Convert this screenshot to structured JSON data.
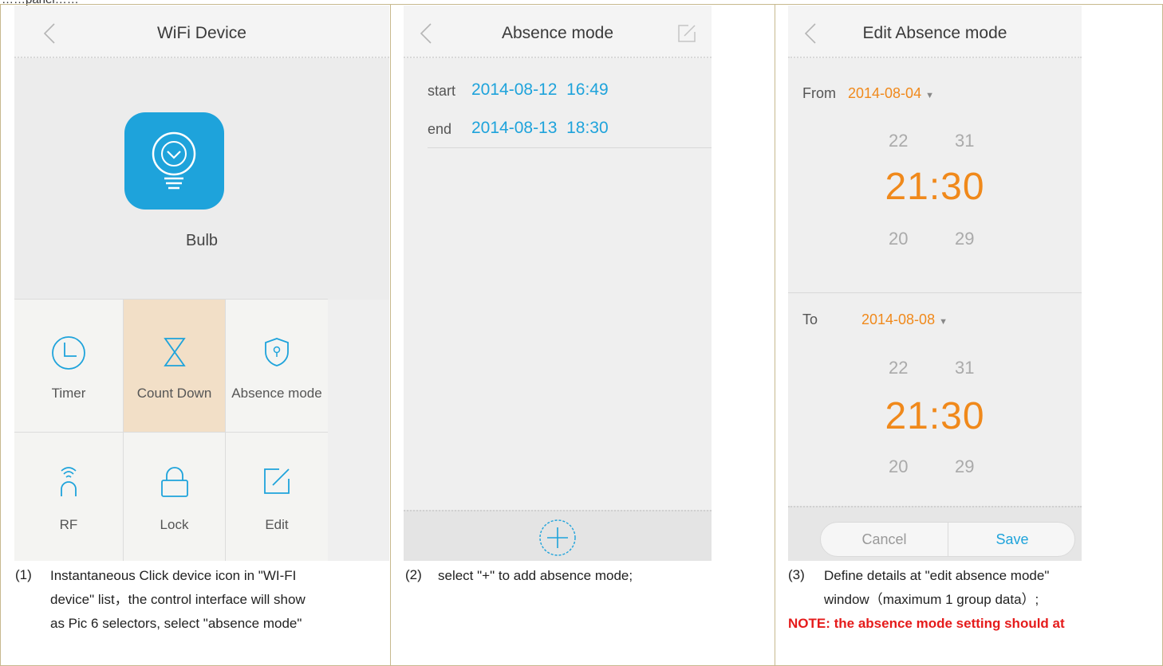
{
  "top_fragment": "……panel……",
  "panel1": {
    "title": "WiFi Device",
    "device_label": "Bulb",
    "menu": [
      "Timer",
      "Count Down",
      "Absence mode",
      "RF",
      "Lock",
      "Edit"
    ],
    "caption_number": "(1)",
    "caption_lines": [
      "Instantaneous Click device icon in \"WI-FI",
      "device\" list，the control interface will show",
      "as Pic 6 selectors, select \"absence mode\""
    ]
  },
  "panel2": {
    "title": "Absence mode",
    "start_label": "start",
    "start_value": "2014-08-12  16:49",
    "end_label": "end",
    "end_value": "2014-08-13  18:30",
    "caption_number": "(2)",
    "caption_text": "select \"+\" to add absence mode;"
  },
  "panel3": {
    "title": "Edit Absence mode",
    "from_label": "From",
    "from_date": "2014-08-04",
    "to_label": "To",
    "to_date": "2014-08-08",
    "picker_prev_hour": "22",
    "picker_prev_min": "31",
    "picker_time": "21:30",
    "picker_next_hour": "20",
    "picker_next_min": "29",
    "cancel_label": "Cancel",
    "save_label": "Save",
    "caption_number": "(3)",
    "caption_lines": [
      "Define details at \"edit absence mode\"",
      "window（maximum 1 group data）;"
    ],
    "note": "NOTE: the absence mode setting should at"
  },
  "colors": {
    "accent_blue": "#1ea3db",
    "accent_orange": "#f0891b",
    "highlight_tile": "#f2dfc7",
    "note_red": "#e51b1b",
    "border": "#c7b98e"
  }
}
